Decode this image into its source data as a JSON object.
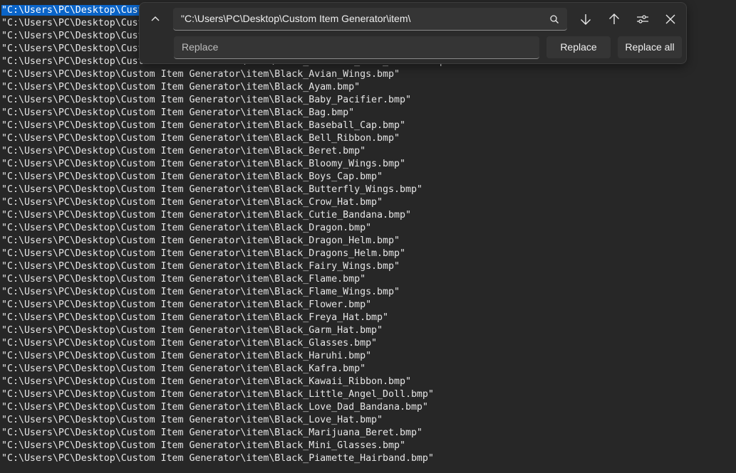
{
  "editor": {
    "selected_text": "\"C:\\Users\\PC\\Desktop\\Cust",
    "lines": [
      "\"C:\\Users\\PC\\Desktop\\Custom Item Generator\\item\\Black_A.bmp\"",
      "\"C:\\Users\\PC\\Desktop\\Custom Item Generator\\item\\Black_B.bmp\"",
      "\"C:\\Users\\PC\\Desktop\\Custom Item Generator\\item\\Black_C.bmp\"",
      "\"C:\\Users\\PC\\Desktop\\Custom Item Generator\\item\\Black_D.bmp\"",
      "\"C:\\Users\\PC\\Desktop\\Custom Item Generator\\item\\Black_Animated_Xmas_Ribbon.bmp\"",
      "\"C:\\Users\\PC\\Desktop\\Custom Item Generator\\item\\Black_Avian_Wings.bmp\"",
      "\"C:\\Users\\PC\\Desktop\\Custom Item Generator\\item\\Black_Ayam.bmp\"",
      "\"C:\\Users\\PC\\Desktop\\Custom Item Generator\\item\\Black_Baby_Pacifier.bmp\"",
      "\"C:\\Users\\PC\\Desktop\\Custom Item Generator\\item\\Black_Bag.bmp\"",
      "\"C:\\Users\\PC\\Desktop\\Custom Item Generator\\item\\Black_Baseball_Cap.bmp\"",
      "\"C:\\Users\\PC\\Desktop\\Custom Item Generator\\item\\Black_Bell_Ribbon.bmp\"",
      "\"C:\\Users\\PC\\Desktop\\Custom Item Generator\\item\\Black_Beret.bmp\"",
      "\"C:\\Users\\PC\\Desktop\\Custom Item Generator\\item\\Black_Bloomy_Wings.bmp\"",
      "\"C:\\Users\\PC\\Desktop\\Custom Item Generator\\item\\Black_Boys_Cap.bmp\"",
      "\"C:\\Users\\PC\\Desktop\\Custom Item Generator\\item\\Black_Butterfly_Wings.bmp\"",
      "\"C:\\Users\\PC\\Desktop\\Custom Item Generator\\item\\Black_Crow_Hat.bmp\"",
      "\"C:\\Users\\PC\\Desktop\\Custom Item Generator\\item\\Black_Cutie_Bandana.bmp\"",
      "\"C:\\Users\\PC\\Desktop\\Custom Item Generator\\item\\Black_Dragon.bmp\"",
      "\"C:\\Users\\PC\\Desktop\\Custom Item Generator\\item\\Black_Dragon_Helm.bmp\"",
      "\"C:\\Users\\PC\\Desktop\\Custom Item Generator\\item\\Black_Dragons_Helm.bmp\"",
      "\"C:\\Users\\PC\\Desktop\\Custom Item Generator\\item\\Black_Fairy_Wings.bmp\"",
      "\"C:\\Users\\PC\\Desktop\\Custom Item Generator\\item\\Black_Flame.bmp\"",
      "\"C:\\Users\\PC\\Desktop\\Custom Item Generator\\item\\Black_Flame_Wings.bmp\"",
      "\"C:\\Users\\PC\\Desktop\\Custom Item Generator\\item\\Black_Flower.bmp\"",
      "\"C:\\Users\\PC\\Desktop\\Custom Item Generator\\item\\Black_Freya_Hat.bmp\"",
      "\"C:\\Users\\PC\\Desktop\\Custom Item Generator\\item\\Black_Garm_Hat.bmp\"",
      "\"C:\\Users\\PC\\Desktop\\Custom Item Generator\\item\\Black_Glasses.bmp\"",
      "\"C:\\Users\\PC\\Desktop\\Custom Item Generator\\item\\Black_Haruhi.bmp\"",
      "\"C:\\Users\\PC\\Desktop\\Custom Item Generator\\item\\Black_Kafra.bmp\"",
      "\"C:\\Users\\PC\\Desktop\\Custom Item Generator\\item\\Black_Kawaii_Ribbon.bmp\"",
      "\"C:\\Users\\PC\\Desktop\\Custom Item Generator\\item\\Black_Little_Angel_Doll.bmp\"",
      "\"C:\\Users\\PC\\Desktop\\Custom Item Generator\\item\\Black_Love_Dad_Bandana.bmp\"",
      "\"C:\\Users\\PC\\Desktop\\Custom Item Generator\\item\\Black_Love_Hat.bmp\"",
      "\"C:\\Users\\PC\\Desktop\\Custom Item Generator\\item\\Black_Marijuana_Beret.bmp\"",
      "\"C:\\Users\\PC\\Desktop\\Custom Item Generator\\item\\Black_Mini_Glasses.bmp\"",
      "\"C:\\Users\\PC\\Desktop\\Custom Item Generator\\item\\Black_Piamette_Hairband.bmp\""
    ]
  },
  "find_replace": {
    "find_value": "\"C:\\Users\\PC\\Desktop\\Custom Item Generator\\item\\",
    "replace_placeholder": "Replace",
    "replace_button": "Replace",
    "replace_all_button": "Replace all",
    "icons": {
      "toggle": "chevron-up-icon",
      "search": "search-icon",
      "next": "arrow-down-icon",
      "previous": "arrow-up-icon",
      "options": "sliders-icon",
      "close": "close-icon"
    }
  },
  "colors": {
    "background": "#272727",
    "selection": "#0a64c8",
    "dialog": "#2b2b2b"
  }
}
